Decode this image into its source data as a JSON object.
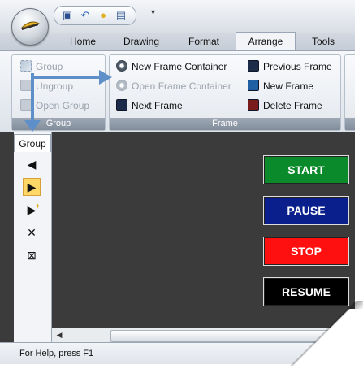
{
  "ribbon": {
    "tabs": [
      "Home",
      "Drawing",
      "Format",
      "Arrange",
      "Tools"
    ],
    "active_tab": "Arrange",
    "group_group": {
      "label": "Group",
      "buttons": [
        "Group",
        "Ungroup",
        "Open Group"
      ]
    },
    "frame_group": {
      "label": "Frame",
      "col1": [
        "New Frame Container",
        "Open Frame Container",
        "Next Frame"
      ],
      "col2": [
        "Previous Frame",
        "New Frame",
        "Delete Frame"
      ]
    }
  },
  "left_panel": {
    "tab_label": "Group",
    "buttons": [
      "◀",
      "▶",
      "▶",
      "✕",
      "⊠"
    ]
  },
  "canvas_buttons": [
    {
      "label": "START",
      "color": "#0a8a2a"
    },
    {
      "label": "PAUSE",
      "color": "#0a1f8c"
    },
    {
      "label": "STOP",
      "color": "#ff1010"
    },
    {
      "label": "RESUME",
      "color": "#000000"
    }
  ],
  "status": {
    "text": "For Help, press F1"
  },
  "colors": {
    "arrow": "#5f8fc8",
    "highlight": "#ffd766"
  }
}
